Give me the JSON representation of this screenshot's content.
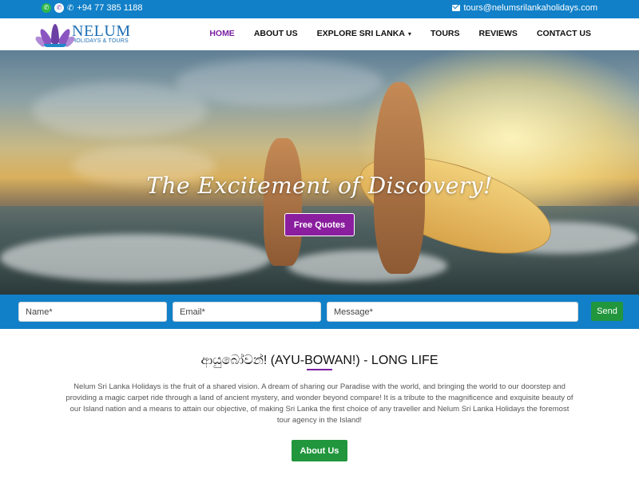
{
  "topbar": {
    "phone": "+94 77 385 1188",
    "email": "tours@nelumsrilankaholidays.com",
    "whatsapp_icon": "whatsapp-icon",
    "viber_icon": "viber-icon",
    "phone_icon": "phone-icon",
    "email_icon": "envelope-icon",
    "background": "#1180c8"
  },
  "logo": {
    "name": "NELUM",
    "tagline": "HOLIDAYS & TOURS"
  },
  "nav": {
    "items": [
      {
        "label": "HOME",
        "active": true
      },
      {
        "label": "ABOUT US"
      },
      {
        "label": "EXPLORE SRI LANKA",
        "has_dropdown": true
      },
      {
        "label": "TOURS"
      },
      {
        "label": "REVIEWS"
      },
      {
        "label": "CONTACT US"
      }
    ],
    "active_color": "#7b1fa2"
  },
  "hero": {
    "title": "The Excitement of Discovery!",
    "button": "Free Quotes",
    "button_color": "#8a1e9e"
  },
  "form": {
    "name_placeholder": "Name*",
    "email_placeholder": "Email*",
    "message_placeholder": "Message*",
    "send_label": "Send",
    "send_color": "#21963d"
  },
  "intro": {
    "heading": "ආයුබෝවන්! (AYU-BOWAN!) - LONG LIFE",
    "body": "Nelum Sri Lanka Holidays is the fruit of a shared vision. A dream of sharing our Paradise with the world, and bringing the world to our doorstep and providing a magic carpet ride through a land of ancient mystery, and wonder beyond compare! It is a tribute to the magnificence and exquisite beauty of our Island nation and a means to attain our objective, of making Sri Lanka the first choice of any traveller and Nelum Sri Lanka Holidays the foremost tour agency in the Island!",
    "button": "About Us"
  }
}
